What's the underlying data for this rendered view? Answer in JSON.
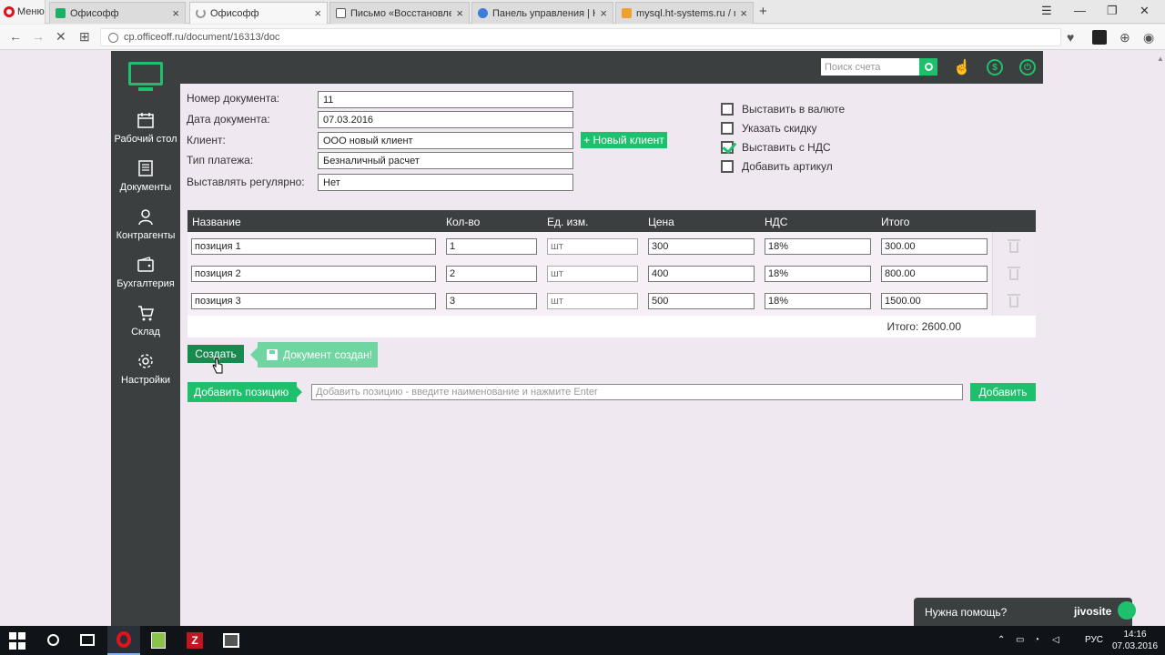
{
  "browser": {
    "menu_label": "Меню",
    "tabs": [
      {
        "title": "Офисофф"
      },
      {
        "title": "Офисофф"
      },
      {
        "title": "Письмо «Восстановлени"
      },
      {
        "title": "Панель управления | HTS"
      },
      {
        "title": "mysql.ht-systems.ru / my"
      }
    ],
    "url": "cp.officeoff.ru/document/16313/doc"
  },
  "sidebar": {
    "items": [
      {
        "label": "Рабочий стол"
      },
      {
        "label": "Документы"
      },
      {
        "label": "Контрагенты"
      },
      {
        "label": "Бухгалтерия"
      },
      {
        "label": "Склад"
      },
      {
        "label": "Настройки"
      }
    ]
  },
  "topbar": {
    "search_placeholder": "Поиск счета"
  },
  "form": {
    "doc_number_label": "Номер документа:",
    "doc_number": "11",
    "doc_date_label": "Дата документа:",
    "doc_date": "07.03.2016",
    "client_label": "Клиент:",
    "client": "ООО новый клиент",
    "new_client_button": "+ Новый клиент",
    "payment_type_label": "Тип платежа:",
    "payment_type": "Безналичный расчет",
    "recurring_label": "Выставлять регулярно:",
    "recurring": "Нет"
  },
  "options": [
    {
      "label": "Выставить в валюте",
      "checked": false
    },
    {
      "label": "Указать скидку",
      "checked": false
    },
    {
      "label": "Выставить с НДС",
      "checked": true
    },
    {
      "label": "Добавить артикул",
      "checked": false
    }
  ],
  "table": {
    "headers": [
      "Название",
      "Кол-во",
      "Ед. изм.",
      "Цена",
      "НДС",
      "Итого"
    ],
    "rows": [
      {
        "name": "позиция 1",
        "qty": "1",
        "unit_placeholder": "шт",
        "price": "300",
        "vat": "18%",
        "total": "300.00"
      },
      {
        "name": "позиция 2",
        "qty": "2",
        "unit_placeholder": "шт",
        "price": "400",
        "vat": "18%",
        "total": "800.00"
      },
      {
        "name": "позиция 3",
        "qty": "3",
        "unit_placeholder": "шт",
        "price": "500",
        "vat": "18%",
        "total": "1500.00"
      }
    ],
    "grand_total": "Итого: 2600.00"
  },
  "actions": {
    "create_button": "Создать",
    "toast": "Документ создан!",
    "add_position_label": "Добавить позицию",
    "add_position_placeholder": "Добавить позицию - введите наименование и нажмите Enter",
    "add_button": "Добавить"
  },
  "help_widget": {
    "text": "Нужна помощь?",
    "brand": "jivosite"
  },
  "taskbar": {
    "language": "РУС",
    "time": "14:16",
    "date": "07.03.2016"
  },
  "colors": {
    "accent": "#1fc06d",
    "sidebar": "#3b3f3f",
    "background": "#f0e8f1"
  }
}
